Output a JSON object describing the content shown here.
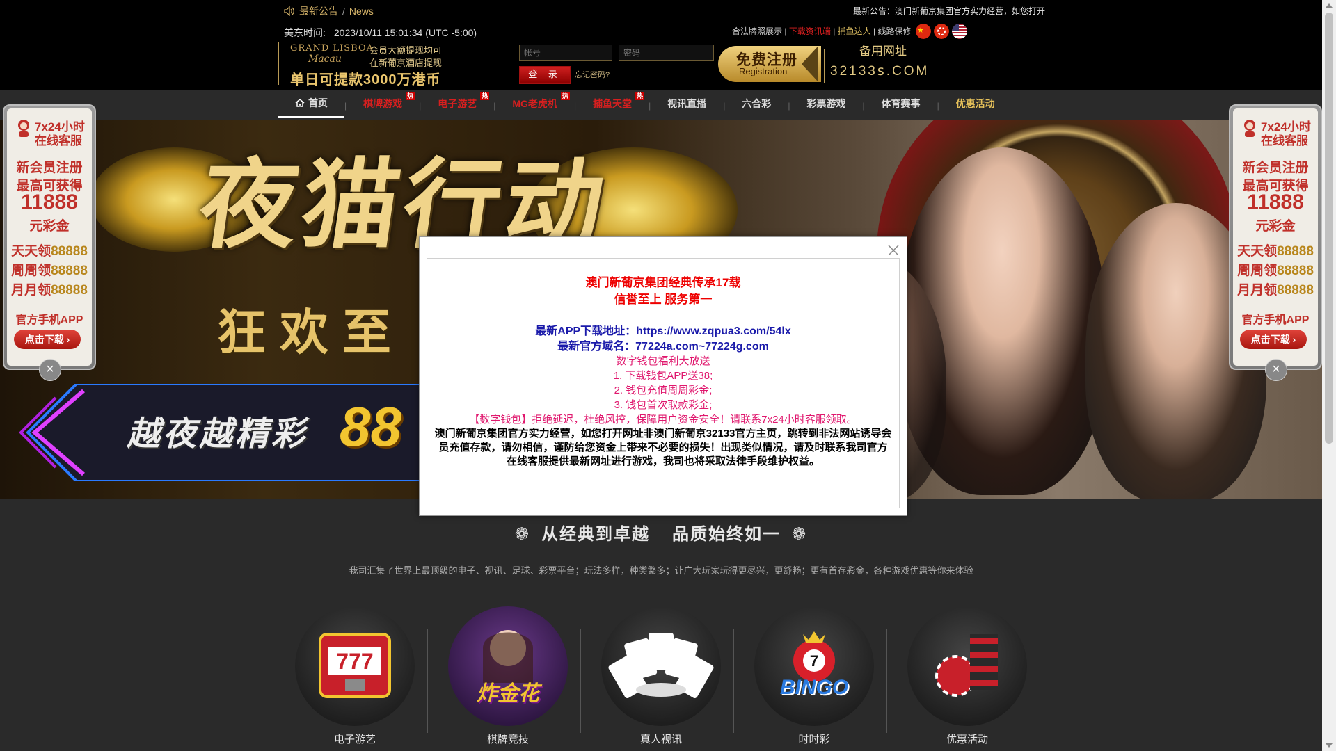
{
  "header": {
    "news_label": "最新公告",
    "news_sep": "/",
    "news_en": "News",
    "ticker": "最新公告：澳门新葡京集团官方实力经营，如您打开",
    "time_label": "美东时间:",
    "time_value": "2023/10/11 15:01:34 (UTC -5:00)",
    "logo": {
      "brand1": "GRAND LISBOA",
      "brand2": "Macau",
      "slogan1": "会员大额提现均可",
      "slogan2": "在新葡京酒店提现",
      "slogan3": "单日可提款3000万港币"
    },
    "login": {
      "account_placeholder": "帐号",
      "password_placeholder": "密码",
      "login_label": "登 录",
      "forgot_label": "忘记密码?"
    },
    "register": {
      "title": "免费注册",
      "sub": "Registration"
    },
    "alt_url": {
      "title": "备用网址",
      "value": "32133ꜱ.COM"
    },
    "toplinks": {
      "license": "合法牌照展示",
      "sep": "|",
      "download": "下载资讯端",
      "fish": "捕鱼达人",
      "line": "线路保修"
    },
    "flags": [
      "cn-flag-icon",
      "hk-flag-icon",
      "us-flag-icon"
    ]
  },
  "nav": {
    "items": [
      {
        "label": "首页",
        "hot": ""
      },
      {
        "label": "棋牌游戏",
        "hot": "热"
      },
      {
        "label": "电子游艺",
        "hot": "热"
      },
      {
        "label": "MG老虎机",
        "hot": "热"
      },
      {
        "label": "捕鱼天堂",
        "hot": "热"
      },
      {
        "label": "视讯直播",
        "hot": ""
      },
      {
        "label": "六合彩",
        "hot": ""
      },
      {
        "label": "彩票游戏",
        "hot": ""
      },
      {
        "label": "体育赛事",
        "hot": ""
      },
      {
        "label": "优惠活动",
        "hot": ""
      }
    ],
    "sep": "|"
  },
  "banner": {
    "title": "夜猫行动",
    "sub": "狂欢至",
    "neon_text": "越夜越精彩",
    "neon_num": "88"
  },
  "float": {
    "cs1": "7x24小时",
    "cs2": "在线客服",
    "l1": "新会员注册",
    "l2": "最高可获得",
    "l3": "11888",
    "l4": "元彩金",
    "l5a": "天天领",
    "l5b": "88888",
    "l6a": "周周领",
    "l6b": "88888",
    "l7a": "月月领",
    "l7b": "88888",
    "app": "官方手机APP",
    "download": "点击下载 ›",
    "close": "×"
  },
  "modal": {
    "line1": "澳门新葡京集团经典传承17载",
    "line2": "信誉至上 服务第一",
    "line3": "最新APP下载地址：https://www.zqpua3.com/54lx",
    "line4": "最新官方域名：77224a.com~77224g.com",
    "line5": "数字钱包福利大放送",
    "line6": "1. 下载钱包APP送38;",
    "line7": "2. 钱包充值周周彩金;",
    "line8": "3. 钱包首次取款彩金;",
    "line9": "【数字钱包】拒绝延迟，杜绝风控，保障用户资金安全！请联系7x24小时客服领取。",
    "para": "澳门新葡京集团官方实力经营，如您打开网址非澳门新葡京32133官方主页，跳转到非法网站诱导会员充值存款，请勿相信，谨防给您资金上带来不必要的损失！出现类似情况，请及时联系我司官方在线客服提供最新网址进行游戏，我司也将采取法律手段维护权益。"
  },
  "section": {
    "title1": "从经典到卓越",
    "title2": "品质始终如一",
    "desc": "我司汇集了世界上最顶级的电子、视讯、足球、彩票平台；玩法多样，种类繁多；让广大玩家玩得更尽兴，更舒畅；更有首存彩金，各种游戏优惠等你来体验"
  },
  "games": [
    {
      "label": "电子游艺",
      "icon": "slot-machine-icon"
    },
    {
      "label": "棋牌竞技",
      "icon": "zhajinhua-icon",
      "logo": "炸金花"
    },
    {
      "label": "真人视讯",
      "icon": "playing-cards-icon"
    },
    {
      "label": "时时彩",
      "icon": "bingo-ball-icon",
      "logo": "BINGO"
    },
    {
      "label": "优惠活动",
      "icon": "casino-chips-icon"
    }
  ],
  "colors": {
    "accent_gold": "#e6c15a",
    "accent_red": "#d81f1f",
    "modal_blue": "#1a1aaa",
    "modal_pink": "#e0186e"
  }
}
